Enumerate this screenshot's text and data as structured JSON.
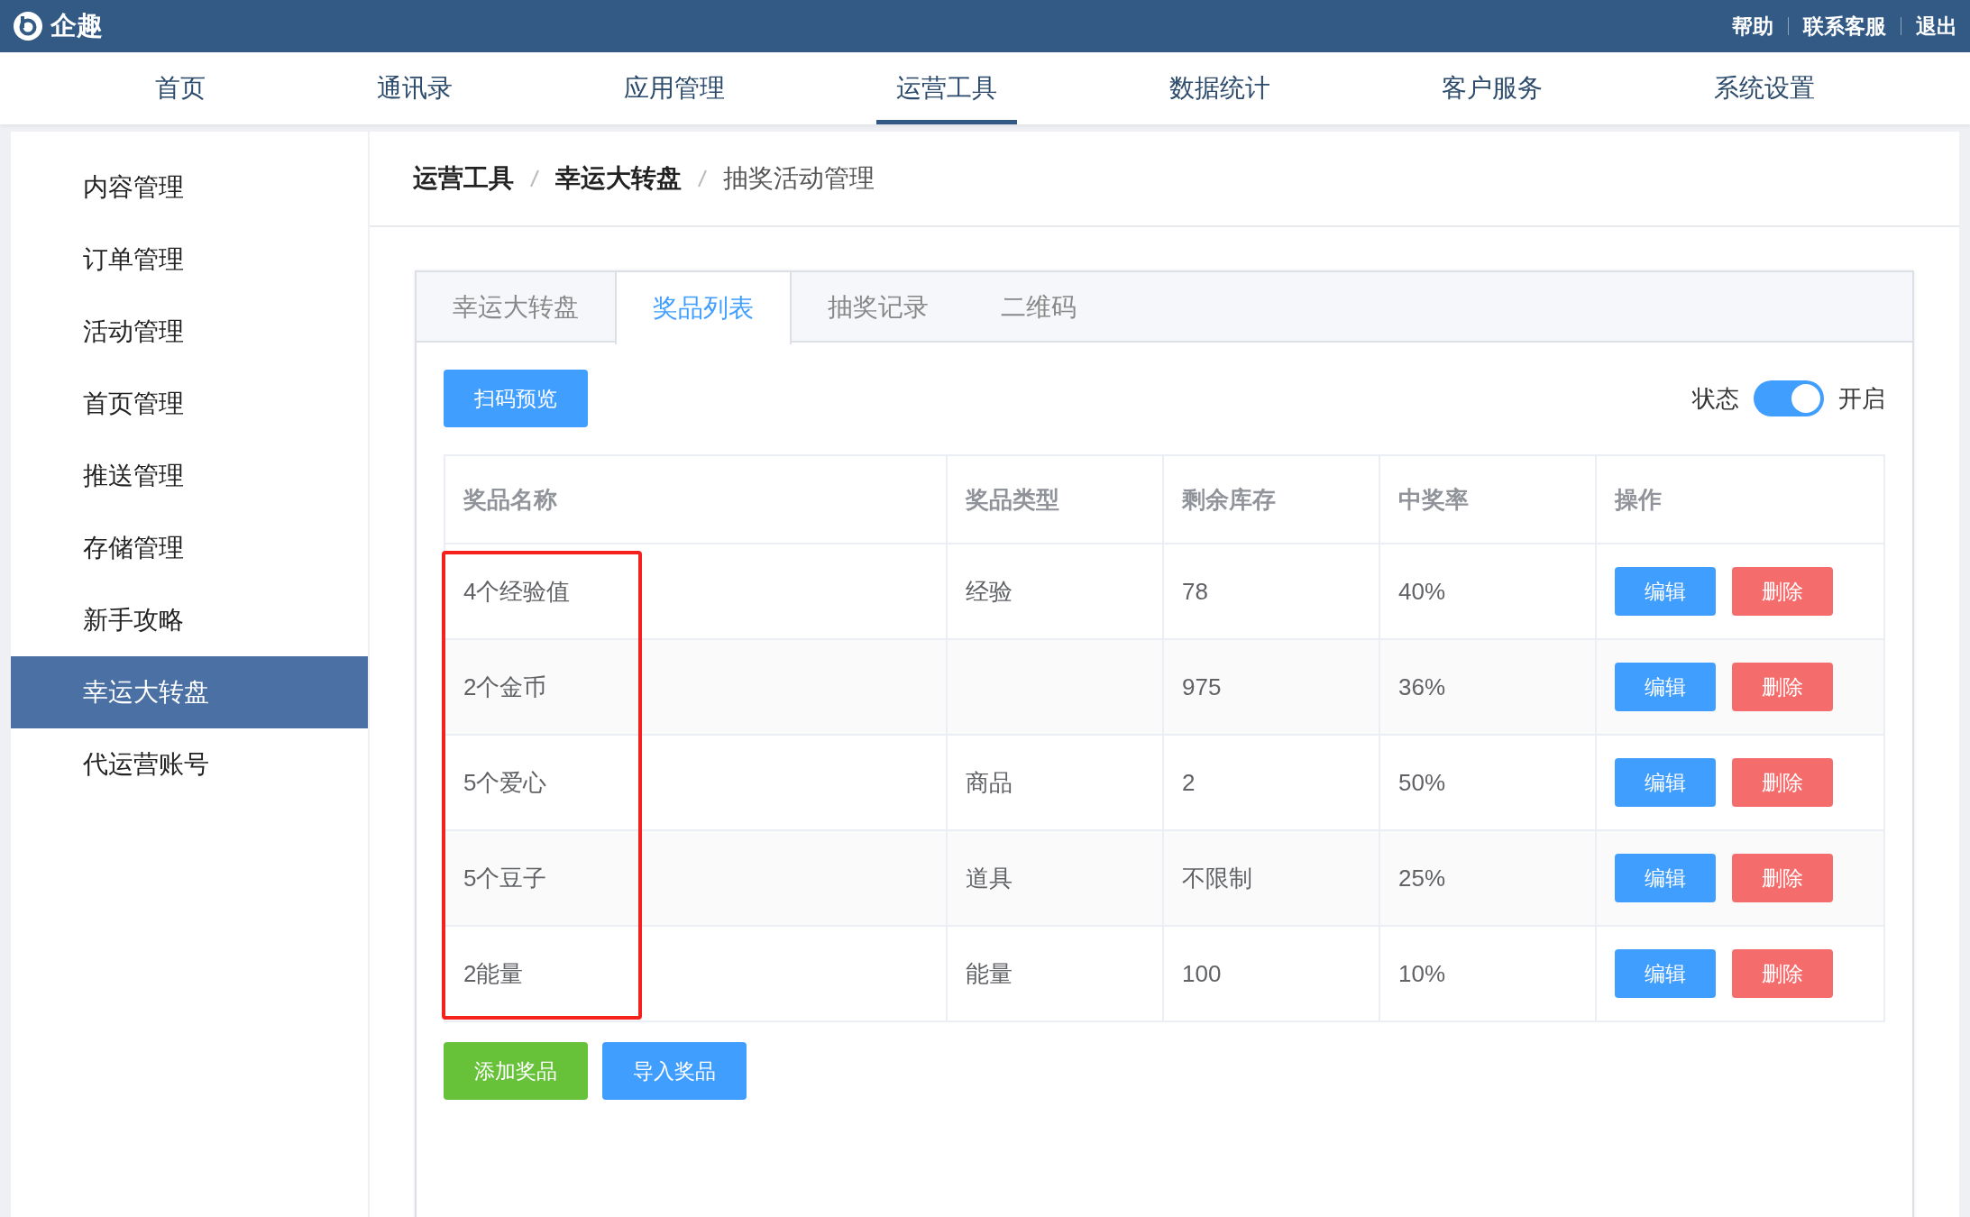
{
  "topbar": {
    "brand": "企趣",
    "links": [
      "帮助",
      "联系客服",
      "退出"
    ]
  },
  "nav": [
    {
      "label": "首页",
      "selected": false
    },
    {
      "label": "通讯录",
      "selected": false
    },
    {
      "label": "应用管理",
      "selected": false
    },
    {
      "label": "运营工具",
      "selected": true
    },
    {
      "label": "数据统计",
      "selected": false
    },
    {
      "label": "客户服务",
      "selected": false
    },
    {
      "label": "系统设置",
      "selected": false
    }
  ],
  "sidebar": {
    "items": [
      {
        "label": "内容管理",
        "selected": false
      },
      {
        "label": "订单管理",
        "selected": false
      },
      {
        "label": "活动管理",
        "selected": false
      },
      {
        "label": "首页管理",
        "selected": false
      },
      {
        "label": "推送管理",
        "selected": false
      },
      {
        "label": "存储管理",
        "selected": false
      },
      {
        "label": "新手攻略",
        "selected": false
      },
      {
        "label": "幸运大转盘",
        "selected": true
      },
      {
        "label": "代运营账号",
        "selected": false
      }
    ]
  },
  "breadcrumb": [
    {
      "label": "运营工具",
      "current": false
    },
    {
      "label": "幸运大转盘",
      "current": false
    },
    {
      "label": "抽奖活动管理",
      "current": true
    }
  ],
  "tabs": [
    {
      "label": "幸运大转盘",
      "selected": false
    },
    {
      "label": "奖品列表",
      "selected": true
    },
    {
      "label": "抽奖记录",
      "selected": false
    },
    {
      "label": "二维码",
      "selected": false
    }
  ],
  "toolbar": {
    "preview_button": "扫码预览",
    "status": {
      "label": "状态",
      "on": true,
      "text": "开启"
    }
  },
  "table": {
    "columns": [
      {
        "label": "奖品名称",
        "highlighted": true
      },
      {
        "label": "奖品类型",
        "highlighted": false
      },
      {
        "label": "剩余库存",
        "highlighted": false
      },
      {
        "label": "中奖率",
        "highlighted": false
      },
      {
        "label": "操作",
        "highlighted": false
      }
    ],
    "rows": [
      {
        "name": "4个经验值",
        "type": "经验",
        "stock": "78",
        "rate": "40%",
        "actions": [
          {
            "kind": "edit",
            "label": "编辑"
          },
          {
            "kind": "delete",
            "label": "删除"
          }
        ]
      },
      {
        "name": "2个金币",
        "stock": "975",
        "rate": "36%",
        "actions": [
          {
            "kind": "edit",
            "label": "编辑"
          },
          {
            "kind": "delete",
            "label": "删除"
          }
        ]
      },
      {
        "name": "5个爱心",
        "type": "商品",
        "stock": "2",
        "rate": "50%",
        "actions": [
          {
            "kind": "edit",
            "label": "编辑"
          },
          {
            "kind": "delete",
            "label": "删除"
          }
        ]
      },
      {
        "name": "5个豆子",
        "type": "道具",
        "stock": "不限制",
        "rate": "25%",
        "actions": [
          {
            "kind": "edit",
            "label": "编辑"
          },
          {
            "kind": "delete",
            "label": "删除"
          }
        ]
      },
      {
        "name": "2能量",
        "type": "能量",
        "stock": "100",
        "rate": "10%",
        "actions": [
          {
            "kind": "edit",
            "label": "编辑"
          },
          {
            "kind": "delete",
            "label": "删除"
          }
        ]
      }
    ]
  },
  "footer_buttons": [
    {
      "kind": "add",
      "label": "添加奖品"
    },
    {
      "kind": "import",
      "label": "导入奖品"
    }
  ]
}
